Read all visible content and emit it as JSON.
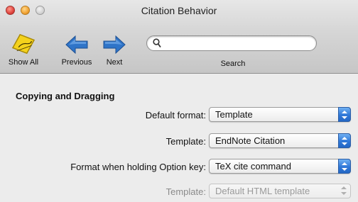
{
  "window": {
    "title": "Citation Behavior"
  },
  "toolbar": {
    "show_all_label": "Show All",
    "previous_label": "Previous",
    "next_label": "Next",
    "search_label": "Search",
    "search_value": "",
    "colors": {
      "arrow": "#2f74c8",
      "cite_badge": "#f4d21c"
    }
  },
  "content": {
    "section_title": "Copying and Dragging",
    "rows": [
      {
        "label": "Default format:",
        "value": "Template",
        "enabled": true
      },
      {
        "label": "Template:",
        "value": "EndNote Citation",
        "enabled": true
      },
      {
        "label": "Format when holding Option key:",
        "value": "TeX cite command",
        "enabled": true
      },
      {
        "label": "Template:",
        "value": "Default HTML template",
        "enabled": false
      }
    ]
  }
}
